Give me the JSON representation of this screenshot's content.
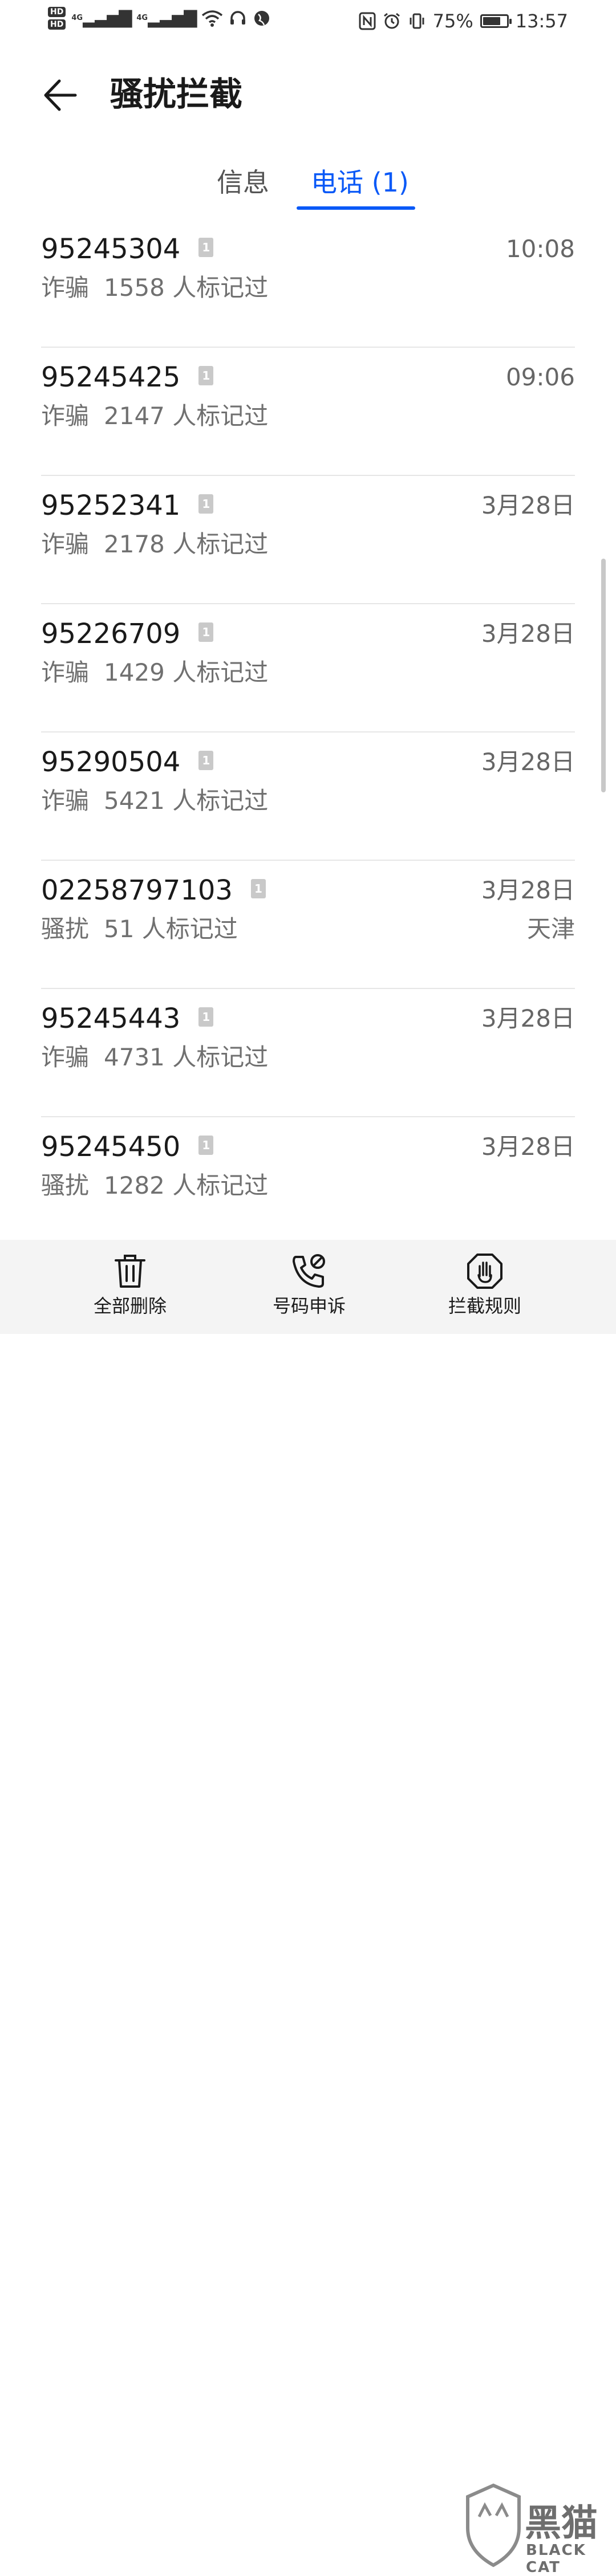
{
  "status_bar": {
    "hd1": "HD",
    "hd2": "HD",
    "net1": "4G",
    "net2": "4G",
    "battery_text": "75%",
    "battery_level": 0.75,
    "time": "13:57"
  },
  "header": {
    "title": "骚扰拦截"
  },
  "tabs": {
    "messages": "信息",
    "calls": "电话 (1)"
  },
  "calls": [
    {
      "number": "95245304",
      "sim": "1",
      "time": "10:08",
      "tag": "诈骗",
      "desc": "1558 人标记过",
      "location": ""
    },
    {
      "number": "95245425",
      "sim": "1",
      "time": "09:06",
      "tag": "诈骗",
      "desc": "2147 人标记过",
      "location": ""
    },
    {
      "number": "95252341",
      "sim": "1",
      "time": "3月28日",
      "tag": "诈骗",
      "desc": "2178 人标记过",
      "location": ""
    },
    {
      "number": "95226709",
      "sim": "1",
      "time": "3月28日",
      "tag": "诈骗",
      "desc": "1429 人标记过",
      "location": ""
    },
    {
      "number": "95290504",
      "sim": "1",
      "time": "3月28日",
      "tag": "诈骗",
      "desc": "5421 人标记过",
      "location": ""
    },
    {
      "number": "02258797103",
      "sim": "1",
      "time": "3月28日",
      "tag": "骚扰",
      "desc": "51 人标记过",
      "location": "天津"
    },
    {
      "number": "95245443",
      "sim": "1",
      "time": "3月28日",
      "tag": "诈骗",
      "desc": "4731 人标记过",
      "location": ""
    },
    {
      "number": "95245450",
      "sim": "1",
      "time": "3月28日",
      "tag": "骚扰",
      "desc": "1282 人标记过",
      "location": ""
    }
  ],
  "bottom_bar": {
    "delete_all": "全部删除",
    "appeal": "号码申诉",
    "rules": "拦截规则"
  },
  "watermark": {
    "text": "黑猫",
    "sub": "BLACK CAT"
  },
  "colors": {
    "accent": "#0a59f7"
  }
}
